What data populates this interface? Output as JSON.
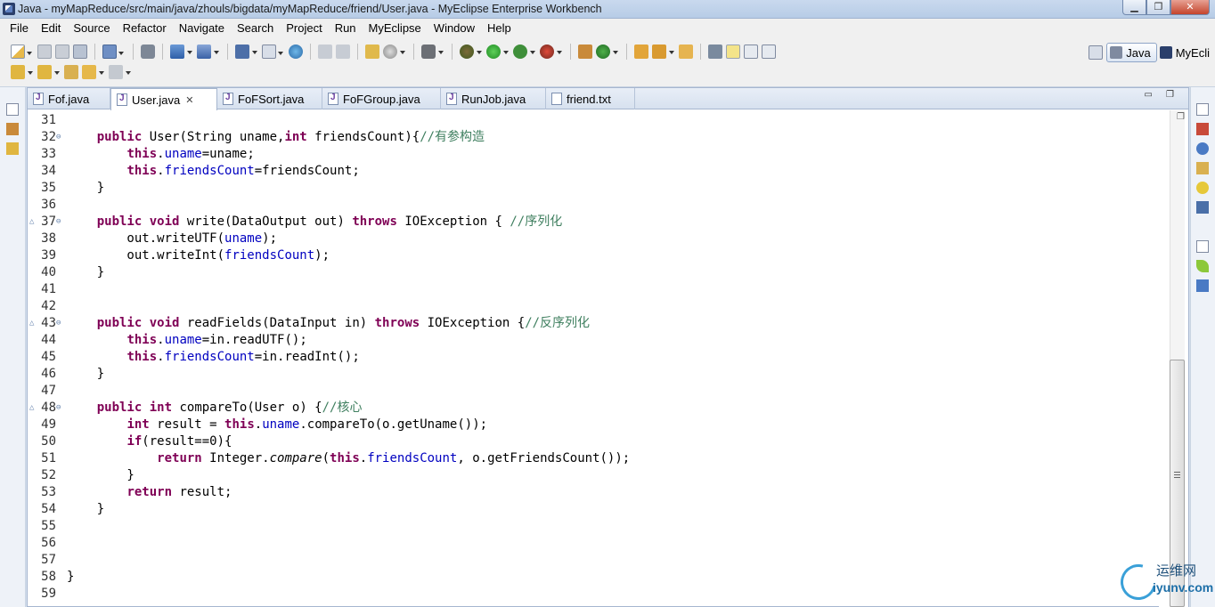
{
  "window": {
    "title": "Java - myMapReduce/src/main/java/zhouls/bigdata/myMapReduce/friend/User.java - MyEclipse Enterprise Workbench",
    "minimize": "▁",
    "maximize": "❐",
    "close": "✕"
  },
  "menu": [
    "File",
    "Edit",
    "Source",
    "Refactor",
    "Navigate",
    "Search",
    "Project",
    "Run",
    "MyEclipse",
    "Window",
    "Help"
  ],
  "perspectives": {
    "java": "Java",
    "myeclipse": "MyEcli"
  },
  "tabs": [
    {
      "label": "Fof.java",
      "icon": "java-file-icon"
    },
    {
      "label": "User.java",
      "icon": "java-file-icon",
      "active": true,
      "close": "✕"
    },
    {
      "label": "FoFSort.java",
      "icon": "java-file-icon"
    },
    {
      "label": "FoFGroup.java",
      "icon": "java-file-icon"
    },
    {
      "label": "RunJob.java",
      "icon": "java-file-icon"
    },
    {
      "label": "friend.txt",
      "icon": "text-file-icon"
    }
  ],
  "code": {
    "lines": [
      {
        "n": "31",
        "t": ""
      },
      {
        "n": "32",
        "t": "    public User(String uname,int friendsCount){//有参构造"
      },
      {
        "n": "33",
        "t": "        this.uname=uname;"
      },
      {
        "n": "34",
        "t": "        this.friendsCount=friendsCount;"
      },
      {
        "n": "35",
        "t": "    }"
      },
      {
        "n": "36",
        "t": ""
      },
      {
        "n": "37",
        "t": "    public void write(DataOutput out) throws IOException { //序列化"
      },
      {
        "n": "38",
        "t": "        out.writeUTF(uname);"
      },
      {
        "n": "39",
        "t": "        out.writeInt(friendsCount);"
      },
      {
        "n": "40",
        "t": "    }"
      },
      {
        "n": "41",
        "t": ""
      },
      {
        "n": "42",
        "t": ""
      },
      {
        "n": "43",
        "t": "    public void readFields(DataInput in) throws IOException {//反序列化"
      },
      {
        "n": "44",
        "t": "        this.uname=in.readUTF();"
      },
      {
        "n": "45",
        "t": "        this.friendsCount=in.readInt();"
      },
      {
        "n": "46",
        "t": "    }"
      },
      {
        "n": "47",
        "t": ""
      },
      {
        "n": "48",
        "t": "    public int compareTo(User o) {//核心"
      },
      {
        "n": "49",
        "t": "        int result = this.uname.compareTo(o.getUname());"
      },
      {
        "n": "50",
        "t": "        if(result==0){"
      },
      {
        "n": "51",
        "t": "            return Integer.compare(this.friendsCount, o.getFriendsCount());"
      },
      {
        "n": "52",
        "t": "        }"
      },
      {
        "n": "53",
        "t": "        return result;"
      },
      {
        "n": "54",
        "t": "    }"
      },
      {
        "n": "55",
        "t": ""
      },
      {
        "n": "56",
        "t": ""
      },
      {
        "n": "57",
        "t": ""
      },
      {
        "n": "58",
        "t": "}"
      },
      {
        "n": "59",
        "t": ""
      }
    ]
  },
  "watermark": {
    "cn": "运维网",
    "en": "iyunv.com"
  },
  "colors": {
    "keyword": "#7f0055",
    "field": "#0000c0",
    "comment": "#3f7f5f"
  }
}
